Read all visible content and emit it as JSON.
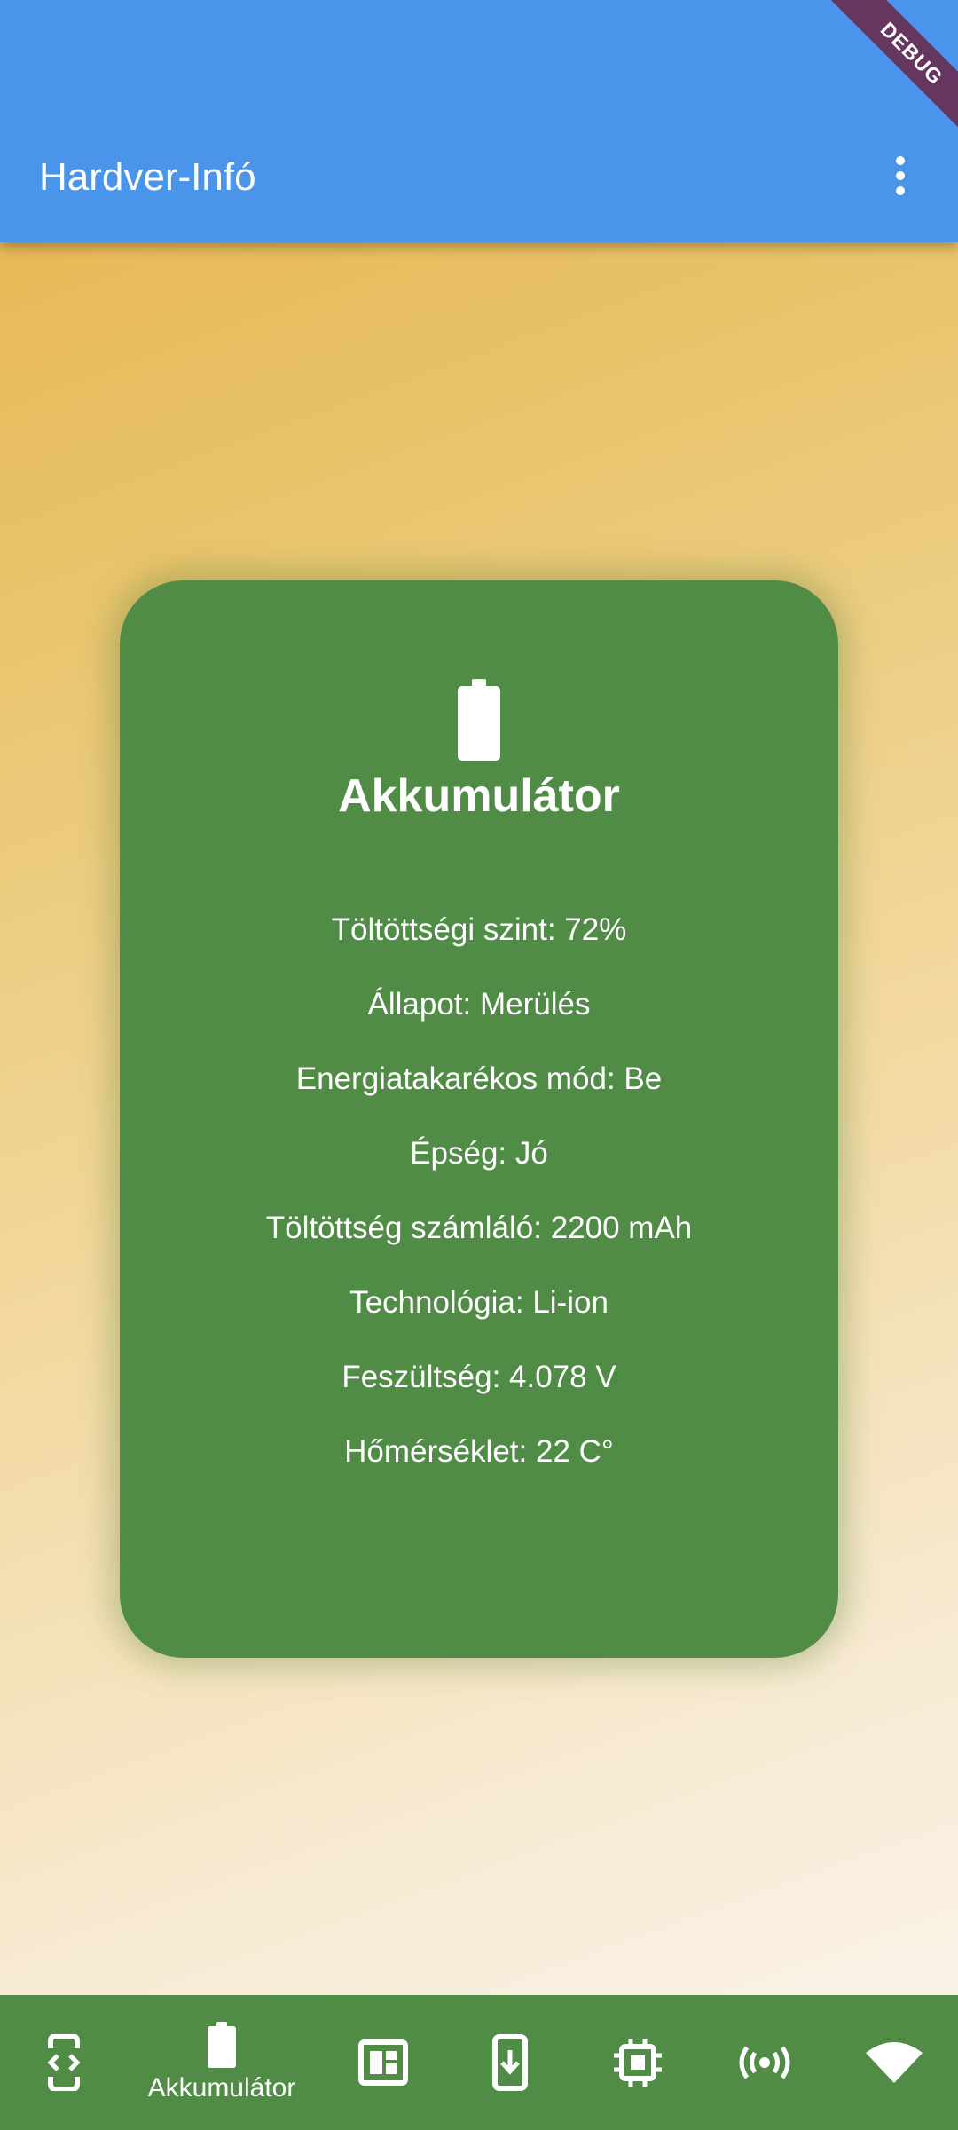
{
  "app_bar": {
    "title": "Hardver-Infó",
    "menu_icon": "more-vert-icon",
    "background": "#4a94ea"
  },
  "debug_banner": "DEBUG",
  "card": {
    "icon": "battery-icon",
    "title": "Akkumulátor",
    "background": "#518c47",
    "rows": [
      "Töltöttségi szint: 72%",
      "Állapot: Merülés",
      "Energiatakarékos mód: Be",
      "Épség: Jó",
      "Töltöttség számláló: 2200 mAh",
      "Technológia: Li-ion",
      "Feszültség: 4.078 V",
      "Hőmérséklet: 22 C°"
    ]
  },
  "bottom_nav": {
    "background": "#518c47",
    "selected_index": 1,
    "items": [
      {
        "icon": "developer-mode-icon"
      },
      {
        "icon": "battery-icon",
        "label": "Akkumulátor"
      },
      {
        "icon": "dashboard-icon"
      },
      {
        "icon": "system-update-icon"
      },
      {
        "icon": "memory-chip-icon"
      },
      {
        "icon": "sensors-icon"
      },
      {
        "icon": "wifi-icon"
      }
    ]
  }
}
